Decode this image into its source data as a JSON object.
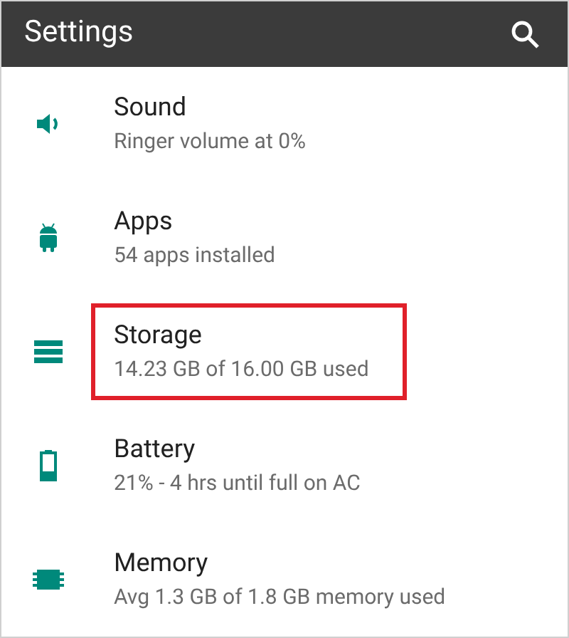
{
  "app_bar": {
    "title": "Settings"
  },
  "items": [
    {
      "kind": "sound",
      "title": "Sound",
      "summary": "Ringer volume at 0%",
      "highlighted": false
    },
    {
      "kind": "apps",
      "title": "Apps",
      "summary": "54 apps installed",
      "highlighted": false
    },
    {
      "kind": "storage",
      "title": "Storage",
      "summary": "14.23 GB of 16.00 GB used",
      "highlighted": true
    },
    {
      "kind": "battery",
      "title": "Battery",
      "summary": "21% - 4 hrs until full on AC",
      "highlighted": false
    },
    {
      "kind": "memory",
      "title": "Memory",
      "summary": "Avg 1.3 GB of 1.8 GB memory used",
      "highlighted": false
    }
  ]
}
